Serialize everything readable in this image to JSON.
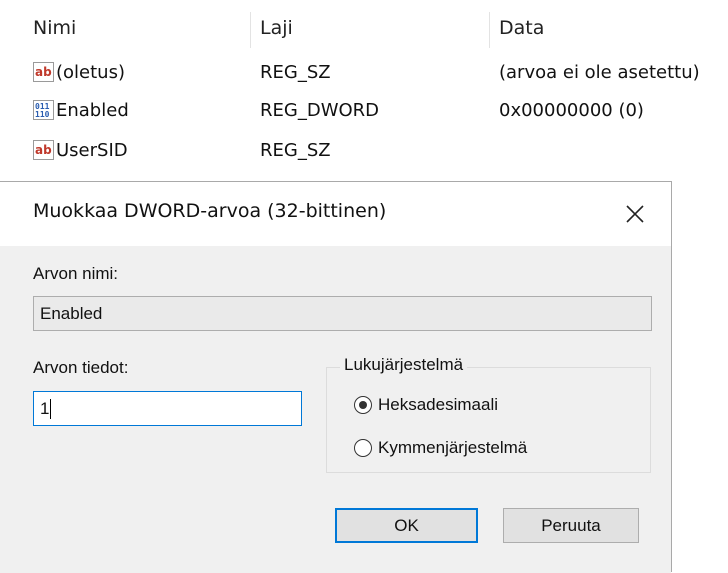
{
  "columns": {
    "name": "Nimi",
    "type": "Laji",
    "data": "Data"
  },
  "rows": [
    {
      "icon": "string-value-icon",
      "icon_text": "ab",
      "name": "(oletus)",
      "type": "REG_SZ",
      "data": "(arvoa ei ole asetettu)"
    },
    {
      "icon": "dword-value-icon",
      "icon_text": "011 110",
      "name": "Enabled",
      "type": "REG_DWORD",
      "data": "0x00000000 (0)"
    },
    {
      "icon": "string-value-icon",
      "icon_text": "ab",
      "name": "UserSID",
      "type": "REG_SZ",
      "data": ""
    }
  ],
  "dialog": {
    "title": "Muokkaa DWORD-arvoa (32-bittinen)",
    "close_symbol": "✕",
    "value_name_label": "Arvon nimi:",
    "value_name": "Enabled",
    "value_data_label": "Arvon tiedot:",
    "value_data": "1",
    "base_group_label": "Lukujärjestelmä",
    "base_options": [
      {
        "label": "Heksadesimaali",
        "selected": true
      },
      {
        "label": "Kymmenjärjestelmä",
        "selected": false
      }
    ],
    "ok_label": "OK",
    "cancel_label": "Peruuta"
  },
  "colors": {
    "accent": "#0078d7",
    "client_background": "#f0f0f0",
    "string_icon": "#c0392b",
    "dword_icon": "#2a5db0"
  }
}
